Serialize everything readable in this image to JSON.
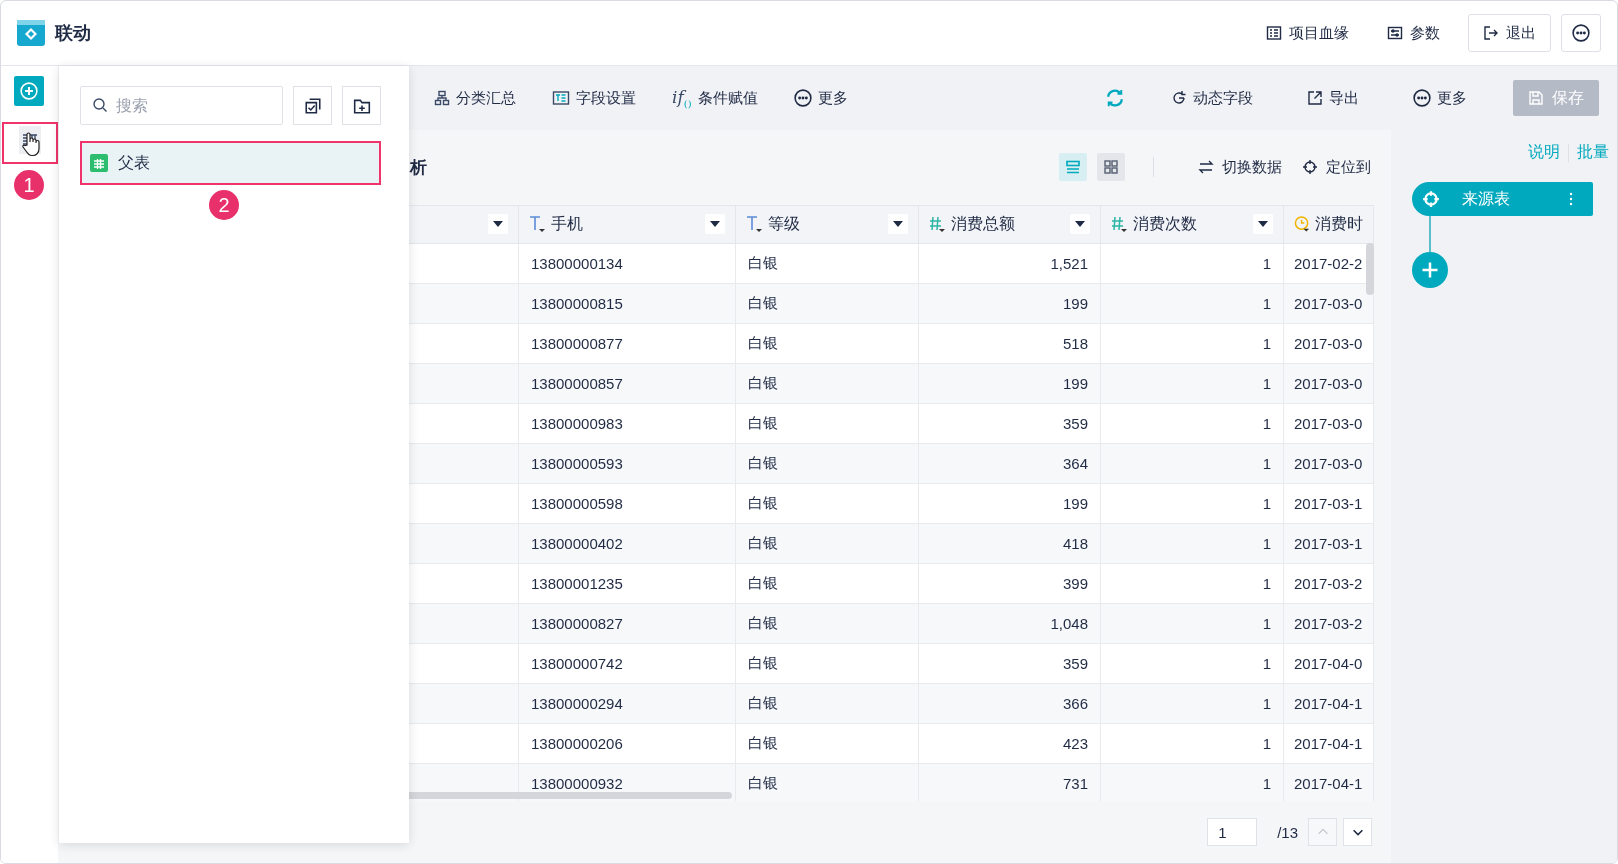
{
  "header": {
    "title": "联动",
    "actions": [
      {
        "label": "项目血缘",
        "kind": "lineage"
      },
      {
        "label": "参数",
        "kind": "params"
      },
      {
        "label": "退出",
        "kind": "exit"
      }
    ]
  },
  "toolbar": {
    "left": [
      {
        "label": "分类汇总",
        "kind": "group"
      },
      {
        "label": "字段设置",
        "kind": "fields"
      },
      {
        "label": "条件赋值",
        "kind": "condition",
        "glyph": "if",
        "glyph_sub": "()"
      },
      {
        "label": "更多",
        "kind": "more"
      }
    ],
    "right": [
      {
        "label": "动态字段",
        "kind": "dynamic"
      },
      {
        "label": "导出",
        "kind": "export"
      },
      {
        "label": "更多",
        "kind": "more"
      }
    ],
    "save": {
      "label": "保存",
      "disabled": true
    }
  },
  "popup": {
    "search": {
      "placeholder": "搜索"
    },
    "items": [
      {
        "label": "父表",
        "selected": true
      }
    ]
  },
  "annotations": [
    {
      "label": "1"
    },
    {
      "label": "2"
    }
  ],
  "content": {
    "title": "析",
    "views": [
      {
        "kind": "list",
        "selected": true
      },
      {
        "kind": "grid",
        "selected": false
      }
    ],
    "actions": [
      {
        "label": "切换数据",
        "kind": "switch"
      },
      {
        "label": "定位到",
        "kind": "locate"
      }
    ]
  },
  "table": {
    "columns": [
      {
        "label": "手机",
        "kind": "text"
      },
      {
        "label": "等级",
        "kind": "text"
      },
      {
        "label": "消费总额",
        "kind": "number"
      },
      {
        "label": "消费次数",
        "kind": "number"
      },
      {
        "label": "消费时",
        "kind": "date"
      }
    ],
    "rows": [
      [
        "13800000134",
        "白银",
        "1,521",
        "1",
        "2017-02-2"
      ],
      [
        "13800000815",
        "白银",
        "199",
        "1",
        "2017-03-0"
      ],
      [
        "13800000877",
        "白银",
        "518",
        "1",
        "2017-03-0"
      ],
      [
        "13800000857",
        "白银",
        "199",
        "1",
        "2017-03-0"
      ],
      [
        "13800000983",
        "白银",
        "359",
        "1",
        "2017-03-0"
      ],
      [
        "13800000593",
        "白银",
        "364",
        "1",
        "2017-03-0"
      ],
      [
        "13800000598",
        "白银",
        "199",
        "1",
        "2017-03-1"
      ],
      [
        "13800000402",
        "白银",
        "418",
        "1",
        "2017-03-1"
      ],
      [
        "13800001235",
        "白银",
        "399",
        "1",
        "2017-03-2"
      ],
      [
        "13800000827",
        "白银",
        "1,048",
        "1",
        "2017-03-2"
      ],
      [
        "13800000742",
        "白银",
        "359",
        "1",
        "2017-04-0"
      ],
      [
        "13800000294",
        "白银",
        "366",
        "1",
        "2017-04-1"
      ],
      [
        "13800000206",
        "白银",
        "423",
        "1",
        "2017-04-1"
      ],
      [
        "13800000932",
        "白银",
        "731",
        "1",
        "2017-04-1"
      ]
    ]
  },
  "pagination": {
    "page": "1",
    "total": "/13"
  },
  "flow": {
    "links": [
      "说明",
      "批量"
    ],
    "node": "来源表"
  }
}
